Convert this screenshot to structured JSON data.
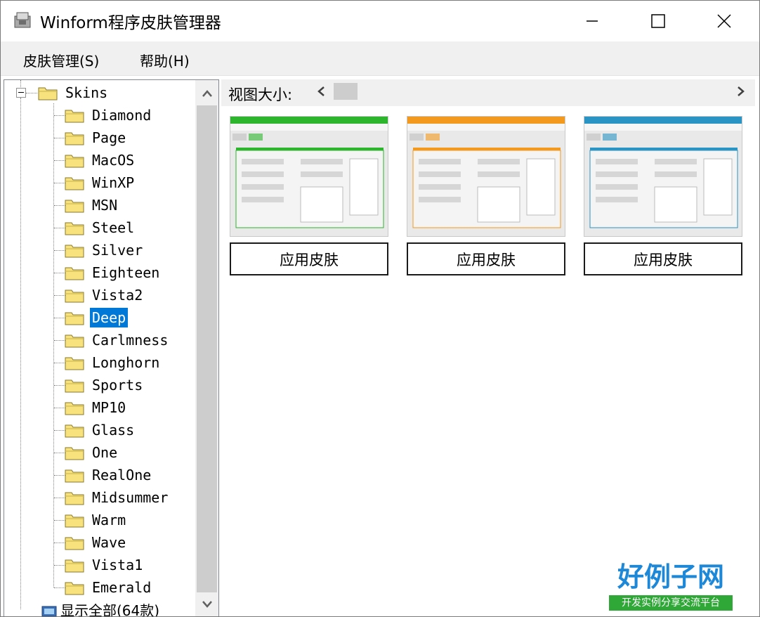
{
  "window": {
    "title": "Winform程序皮肤管理器"
  },
  "menu": {
    "skin_manage": "皮肤管理(S)",
    "help": "帮助(H)"
  },
  "tree": {
    "root": "Skins",
    "items": [
      "Diamond",
      "Page",
      "MacOS",
      "WinXP",
      "MSN",
      "Steel",
      "Silver",
      "Eighteen",
      "Vista2",
      "Deep",
      "Carlmness",
      "Longhorn",
      "Sports",
      "MP10",
      "Glass",
      "One",
      "RealOne",
      "Midsummer",
      "Warm",
      "Wave",
      "Vista1",
      "Emerald"
    ],
    "selected": "Deep",
    "show_all": "显示全部(64款)"
  },
  "viewer": {
    "size_label": "视图大小:"
  },
  "cards": [
    {
      "apply_label": "应用皮肤",
      "accent": "#2db52d"
    },
    {
      "apply_label": "应用皮肤",
      "accent": "#f39a1e"
    },
    {
      "apply_label": "应用皮肤",
      "accent": "#2a94c4"
    }
  ],
  "logo": {
    "title": "好例子网",
    "subtitle": "开发实例分享交流平台"
  },
  "colors": {
    "selection": "#0078d7",
    "logo_blue": "#1e88d8",
    "logo_green": "#2fa838"
  }
}
